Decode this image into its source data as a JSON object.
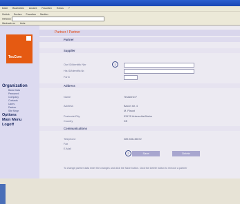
{
  "browser": {
    "title": "",
    "menu": [
      "Datei",
      "Bearbeiten",
      "Ansicht",
      "Favoriten",
      "Extras",
      "?"
    ],
    "toolbar": [
      "Zurück",
      "Suchen",
      "Favoriten",
      "Medien"
    ],
    "address_label": "Adresse",
    "links": [
      "Wechseln zu",
      "Links"
    ]
  },
  "app": {
    "logo_text": "TecCom",
    "breadcrumb": "Partner / Partner"
  },
  "sidebar": {
    "organization_label": "Organization",
    "organization_items": [
      "Basic Data",
      "Password",
      "Company",
      "Contacts",
      "Users",
      "Partner",
      "Site Mngr"
    ],
    "options_label": "Options",
    "main_menu_label": "Main Menu",
    "logoff_label": "Logoff"
  },
  "main": {
    "page_title": "Partner",
    "supplier_section": "Supplier",
    "supplier_fields": [
      {
        "label": "Our ID/Identific Nbr"
      },
      {
        "label": "His ID/Identific.Nr."
      },
      {
        "label": "Form"
      }
    ],
    "callout_1": "1",
    "callout_2": "2",
    "address_section": "Address",
    "address_rows": [
      {
        "label": "Name",
        "value": "Testartner7"
      },
      {
        "label": "Address",
        "value": "Bacon str. 4"
      },
      {
        "label": "",
        "value": "M. Plaust"
      },
      {
        "label": "Postcode/City",
        "value": "53178 Unterschleißheim"
      },
      {
        "label": "Country",
        "value": "DE"
      }
    ],
    "comm_section": "Communications",
    "comm_rows": [
      {
        "label": "Telephone",
        "value": "089-536-45672"
      },
      {
        "label": "Fax",
        "value": ""
      },
      {
        "label": "E-Mail",
        "value": ""
      }
    ],
    "help_text": "To change partner data enter the changes and click the Save button. Click the Delete button to remove a partner",
    "save_button": "Save",
    "delete_button": "Delete"
  },
  "colors": {
    "accent_orange": "#e55a12",
    "sidebar_bg": "#dcdaf0",
    "content_bg": "#eceaf2"
  }
}
